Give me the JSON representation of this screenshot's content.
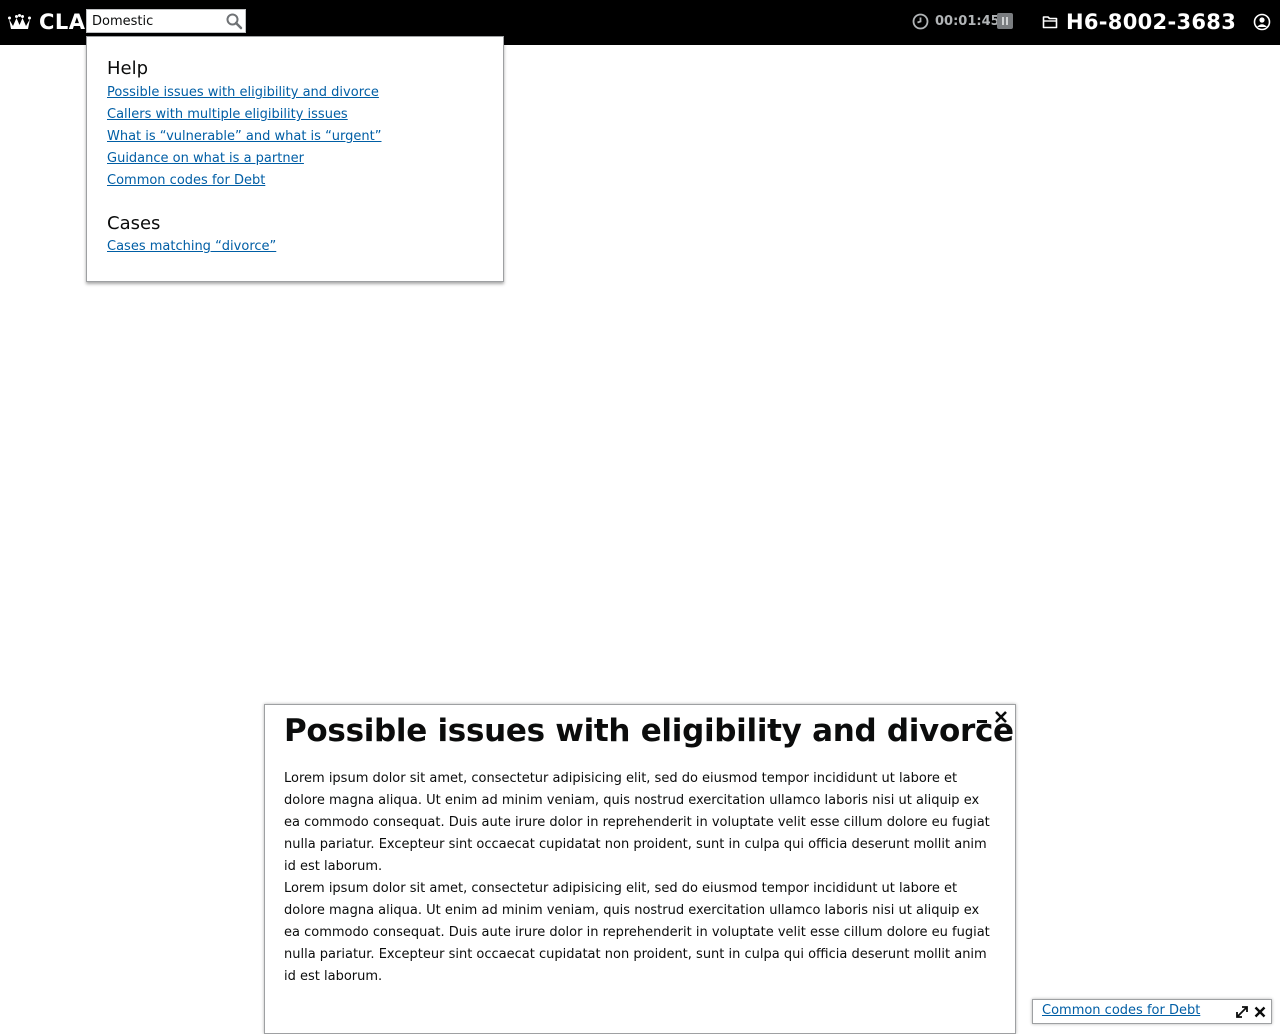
{
  "header": {
    "brand": "CLA",
    "brand_icon": "crown-icon",
    "search": {
      "value": "Domestic",
      "icon": "search-icon"
    },
    "timer": {
      "value": "00:01:45",
      "icon": "clock-icon",
      "pause_icon": "pause-icon"
    },
    "case_ref": {
      "value": "H6-8002-3683",
      "icon": "folder-icon"
    },
    "user_icon": "user-icon",
    "background": "#000000"
  },
  "dropdown": {
    "help_heading": "Help",
    "help_links": [
      "Possible issues with eligibility and divorce",
      "Callers with multiple eligibility issues",
      "What is “vulnerable” and what is “urgent”",
      "Guidance on what is a partner",
      "Common codes for Debt"
    ],
    "cases_heading": "Cases",
    "case_links": [
      "Cases matching “divorce”"
    ],
    "link_color": "#005ea5"
  },
  "panel": {
    "title": "Possible issues with eligibility and divorce",
    "paragraphs": [
      "Lorem ipsum dolor sit amet, consectetur adipisicing elit, sed do eiusmod tempor incididunt ut labore et dolore magna aliqua. Ut enim ad minim veniam, quis nostrud exercitation ullamco laboris nisi ut aliquip ex ea commodo consequat. Duis aute irure dolor in reprehenderit in voluptate velit esse cillum dolore eu fugiat nulla pariatur. Excepteur sint occaecat cupidatat non proident, sunt in culpa qui officia deserunt mollit anim id est laborum.",
      "Lorem ipsum dolor sit amet, consectetur adipisicing elit, sed do eiusmod tempor incididunt ut labore et dolore magna aliqua. Ut enim ad minim veniam, quis nostrud exercitation ullamco laboris nisi ut aliquip ex ea commodo consequat. Duis aute irure dolor in reprehenderit in voluptate velit esse cillum dolore eu fugiat nulla pariatur. Excepteur sint occaecat cupidatat non proident, sunt in culpa qui officia deserunt mollit anim id est laborum."
    ],
    "minimize_icon": "minimize-icon",
    "close_icon": "close-icon"
  },
  "minimized_tab": {
    "label": "Common codes for Debt",
    "expand_icon": "expand-icon",
    "close_icon": "close-icon"
  }
}
